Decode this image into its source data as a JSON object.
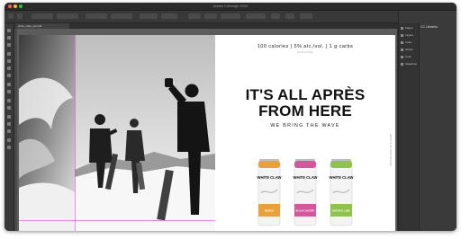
{
  "app": {
    "title": "Adobe InDesign 2020",
    "workspace": "Essentials Classic"
  },
  "document": {
    "tab_label": "white_claw_ad.indd"
  },
  "ad": {
    "claims": "100 calories | 5% alc./vol. | 1 g carbs",
    "claims_sub": "per 12 fl oz can",
    "headline_line1": "IT'S ALL APRÈS",
    "headline_line2": "FROM HERE",
    "tagline": "WE BRING THE WAVE",
    "side_text": "WHITE CLAW HARD SELTZER",
    "cans": [
      {
        "brand": "WHITE CLAW",
        "flavor": "MANGO",
        "color": "#e9a23b"
      },
      {
        "brand": "WHITE CLAW",
        "flavor": "BLACK CHERRY",
        "color": "#d4569b"
      },
      {
        "brand": "WHITE CLAW",
        "flavor": "NATURAL LIME",
        "color": "#8fc34e"
      }
    ]
  },
  "panels": {
    "items": [
      "Pages",
      "Layers",
      "Links",
      "Stroke",
      "Color",
      "Swatches"
    ],
    "active_panel": "CC Libraries"
  },
  "colors": {
    "accent": "#d44ad0",
    "ui_dark": "#323232"
  }
}
